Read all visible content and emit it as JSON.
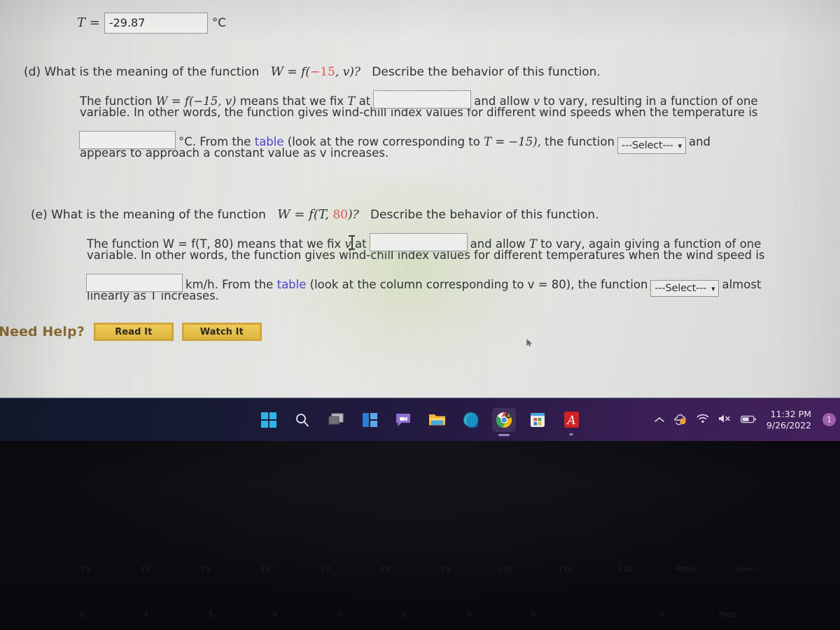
{
  "screen": {
    "top_answer_row": {
      "label": "T =",
      "value": "-29.87",
      "unit": "°C"
    },
    "part_d": {
      "heading_prefix": "(d) What is the meaning of the function",
      "heading_func_W": "W",
      "heading_eq": "=",
      "heading_f": "f(",
      "heading_arg1": "−15",
      "heading_arg2": ", v)?",
      "heading_suffix": "Describe the behavior of this function.",
      "line1_a": "The function",
      "line1_func": "W = f(−15, v)",
      "line1_b": "means that we fix",
      "line1_var": "T",
      "line1_c": "at",
      "line1_d": "and allow",
      "line1_var2": "v",
      "line1_e": "to vary, resulting in a function of one",
      "line2": "variable. In other words, the function gives wind-chill index values for different wind speeds when the temperature is",
      "line3_unit": "°C. From the",
      "line3_link": "table",
      "line3_b": "(look at the row corresponding to",
      "line3_cond": "T = −15),",
      "line3_c": "the function",
      "line3_select": "---Select---",
      "line3_d": "and",
      "line4": "appears to approach a constant value as v increases."
    },
    "part_e": {
      "heading_prefix": "(e) What is the meaning of the function",
      "heading_func": "W = f(T,",
      "heading_arg": "80",
      "heading_close": ")?",
      "heading_suffix": "Describe the behavior of this function.",
      "line1_a": "The function W = f(T, 80) means that we fix",
      "line1_var": "v",
      "line1_b": "at",
      "line1_c": "and allow",
      "line1_var2": "T",
      "line1_d": "to vary, again giving a function of one",
      "line2": "variable. In other words, the function gives wind-chill index values for different temperatures when the wind speed is",
      "line3_unit": "km/h. From the",
      "line3_link": "table",
      "line3_b": "(look at the column corresponding to v = 80), the function",
      "line3_select": "---Select---",
      "line3_c": "almost",
      "line4": "linearly as T increases."
    },
    "need_help": {
      "label": "Need Help?",
      "read_button": "Read It",
      "watch_button": "Watch It"
    },
    "colors": {
      "red_value": "#e2534d",
      "link_blue": "#4b41d6",
      "need_help_brown": "#8a6a33",
      "gold_button": "#e9c24a"
    }
  },
  "taskbar": {
    "icons": [
      {
        "name": "start-icon",
        "label": "Start"
      },
      {
        "name": "search-icon",
        "label": "Search"
      },
      {
        "name": "task-view-icon",
        "label": "Task View"
      },
      {
        "name": "widgets-icon",
        "label": "Widgets"
      },
      {
        "name": "teams-chat-icon",
        "label": "Chat"
      },
      {
        "name": "file-explorer-icon",
        "label": "File Explorer"
      },
      {
        "name": "edge-icon",
        "label": "Microsoft Edge"
      },
      {
        "name": "chrome-icon",
        "label": "Google Chrome"
      },
      {
        "name": "microsoft-store-icon",
        "label": "Microsoft Store"
      },
      {
        "name": "adobe-reader-icon",
        "label": "Adobe Acrobat Reader"
      }
    ],
    "tray": {
      "show_hidden": "chevron-up-icon",
      "onedrive": "onedrive-sync-icon",
      "wifi": "wifi-icon",
      "volume": "speaker-muted-icon",
      "battery": "battery-icon",
      "time": "11:32 PM",
      "date": "9/26/2022",
      "notification_count": "1"
    }
  },
  "keyboard": {
    "function_keys": [
      "F3",
      "F4",
      "F5",
      "F6",
      "F7",
      "F8",
      "F9",
      "F10",
      "F11",
      "F12",
      "PrtScr",
      "Insert"
    ],
    "number_row": [
      "3",
      "4",
      "5",
      "6",
      "7",
      "8",
      "9",
      "0",
      "-",
      "=",
      "Bksp"
    ]
  }
}
